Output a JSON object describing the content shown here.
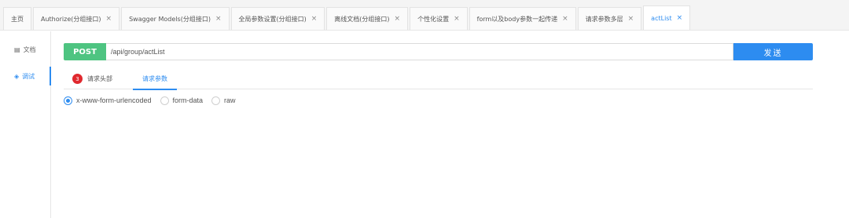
{
  "tabs": [
    {
      "label": "主页",
      "closable": false,
      "active": false
    },
    {
      "label": "Authorize(分组接口)",
      "closable": true,
      "active": false
    },
    {
      "label": "Swagger Models(分组接口)",
      "closable": true,
      "active": false
    },
    {
      "label": "全局参数设置(分组接口)",
      "closable": true,
      "active": false
    },
    {
      "label": "离线文档(分组接口)",
      "closable": true,
      "active": false
    },
    {
      "label": "个性化设置",
      "closable": true,
      "active": false
    },
    {
      "label": "form以及body参数一起传递",
      "closable": true,
      "active": false
    },
    {
      "label": "请求参数多层",
      "closable": true,
      "active": false
    },
    {
      "label": "actList",
      "closable": true,
      "active": true
    }
  ],
  "close_glyph": "×",
  "leftnav": {
    "items": [
      {
        "label": "文档",
        "icon": "doc-icon",
        "glyph": "▤"
      },
      {
        "label": "调试",
        "icon": "debug-icon",
        "glyph": "◈"
      }
    ]
  },
  "request": {
    "method": "POST",
    "url": "/api/group/actList",
    "send_label": "发送"
  },
  "subtabs": {
    "headers_label": "请求头部",
    "headers_count": "3",
    "params_label": "请求参数"
  },
  "body_types": {
    "urlencoded": "x-www-form-urlencoded",
    "formdata": "form-data",
    "raw": "raw",
    "selected": "urlencoded"
  },
  "colors": {
    "accent": "#2d8cf0",
    "post": "#4ec481",
    "badge": "#e0282e"
  }
}
